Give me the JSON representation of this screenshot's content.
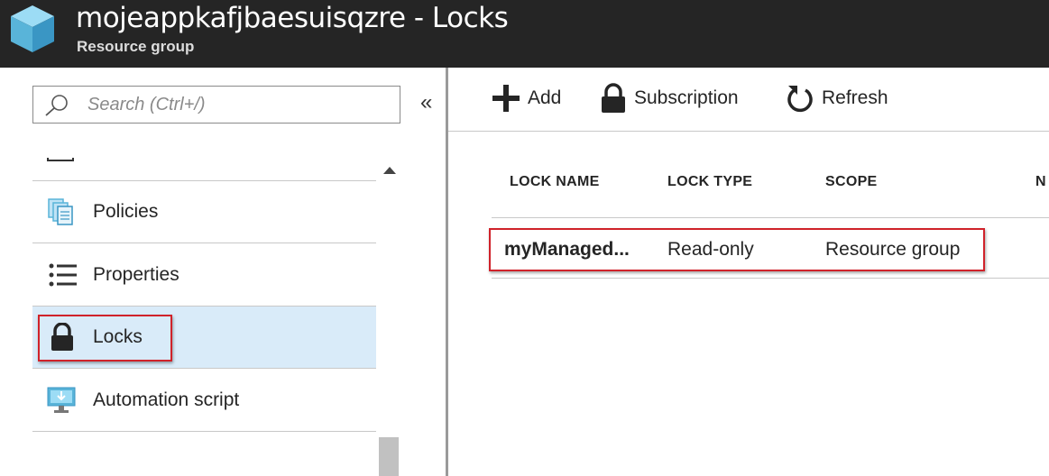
{
  "header": {
    "title": "mojeappkafjbaesuisqzre - Locks",
    "subtitle": "Resource group",
    "icon": "resource-group-cube-icon"
  },
  "sidebar": {
    "search_placeholder": "Search (Ctrl+/)",
    "collapse_glyph": "«",
    "items": [
      {
        "label": "Policies",
        "icon": "policies-icon"
      },
      {
        "label": "Properties",
        "icon": "properties-list-icon"
      },
      {
        "label": "Locks",
        "icon": "lock-icon",
        "selected": true
      },
      {
        "label": "Automation script",
        "icon": "automation-script-icon"
      }
    ]
  },
  "toolbar": {
    "add_label": "Add",
    "subscription_label": "Subscription",
    "refresh_label": "Refresh"
  },
  "table": {
    "columns": [
      "LOCK NAME",
      "LOCK TYPE",
      "SCOPE",
      "N"
    ],
    "rows": [
      {
        "name": "myManaged...",
        "type": "Read-only",
        "scope": "Resource group"
      }
    ]
  },
  "colors": {
    "header_bg": "#252525",
    "selected_bg": "#d9ebf9",
    "highlight_border": "#d0222a",
    "cube_blue": "#59b4d9"
  }
}
